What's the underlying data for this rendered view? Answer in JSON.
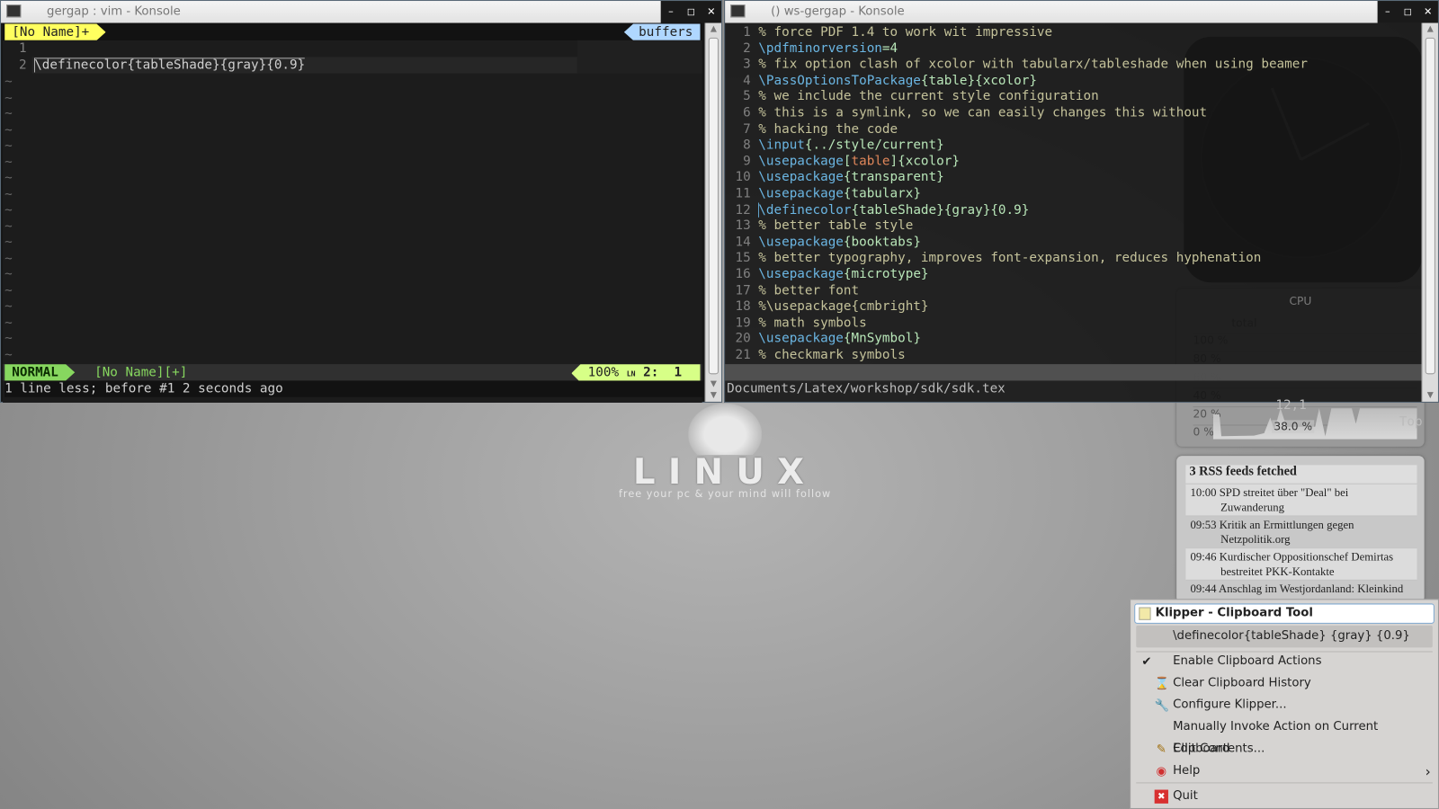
{
  "left_window": {
    "title": "gergap : vim - Konsole",
    "tabline": {
      "buffer": "[No Name]+",
      "right": "buffers"
    },
    "lines": [
      {
        "n": "1",
        "text": ""
      },
      {
        "n": "2",
        "text": "\\definecolor{tableShade}{gray}{0.9}"
      }
    ],
    "tilde": "~",
    "statusline": {
      "mode": "NORMAL",
      "file": "[No Name][+]",
      "percent": "100%",
      "ln_symbol": "LN",
      "pos": "2:  1"
    },
    "message": "1 line less; before #1  2 seconds ago",
    "colors": {
      "mode_bg": "#87d75f",
      "tab_bg": "#ffff5f",
      "buffers_bg": "#afd7ff",
      "pos_bg": "#d7ff87"
    }
  },
  "right_window": {
    "title": "() ws-gergap - Konsole",
    "lines": [
      [
        [
          "com",
          "% force PDF 1.4 to work wit impressive"
        ]
      ],
      [
        [
          "cmd",
          "\\pdfminorversion"
        ],
        [
          "txt",
          "=4"
        ]
      ],
      [
        [
          "com",
          "% fix option clash of xcolor with tabularx/tableshade when using beamer"
        ]
      ],
      [
        [
          "cmd",
          "\\PassOptionsToPackage"
        ],
        [
          "txt",
          "{table}{xcolor}"
        ]
      ],
      [
        [
          "com",
          "% we include the current style configuration"
        ]
      ],
      [
        [
          "com",
          "% this is a symlink, so we can easily changes this without"
        ]
      ],
      [
        [
          "com",
          "% hacking the code"
        ]
      ],
      [
        [
          "cmd",
          "\\input"
        ],
        [
          "txt",
          "{../style/current}"
        ]
      ],
      [
        [
          "cmd",
          "\\usepackage"
        ],
        [
          "txt",
          "["
        ],
        [
          "opt",
          "table"
        ],
        [
          "txt",
          "]{xcolor}"
        ]
      ],
      [
        [
          "cmd",
          "\\usepackage"
        ],
        [
          "txt",
          "{transparent}"
        ]
      ],
      [
        [
          "cmd",
          "\\usepackage"
        ],
        [
          "txt",
          "{tabularx}"
        ]
      ],
      [
        [
          "cmd",
          "\\definecolor"
        ],
        [
          "txt",
          "{tableShade}{gray}{0.9}"
        ]
      ],
      [
        [
          "com",
          "% better table style"
        ]
      ],
      [
        [
          "cmd",
          "\\usepackage"
        ],
        [
          "txt",
          "{booktabs}"
        ]
      ],
      [
        [
          "com",
          "% better typography, improves font-expansion, reduces hyphenation"
        ]
      ],
      [
        [
          "cmd",
          "\\usepackage"
        ],
        [
          "txt",
          "{microtype}"
        ]
      ],
      [
        [
          "com",
          "% better font"
        ]
      ],
      [
        [
          "com",
          "%\\usepackage{cmbright}"
        ]
      ],
      [
        [
          "com",
          "% math symbols"
        ]
      ],
      [
        [
          "cmd",
          "\\usepackage"
        ],
        [
          "txt",
          "{MnSymbol}"
        ]
      ],
      [
        [
          "com",
          "% checkmark symbols"
        ]
      ]
    ],
    "statusline": {
      "file": "Documents/Latex/workshop/sdk/sdk.tex",
      "pos": "12,1",
      "scroll": "Top"
    }
  },
  "desktop": {
    "logo_text": "LINUX",
    "logo_tagline": "free your pc & your mind will follow"
  },
  "cpu_widget": {
    "title": "CPU",
    "legend": "total",
    "ticks": [
      "100 %",
      "80 %",
      "60 %",
      "40 %",
      "20 %",
      "0 %"
    ],
    "value": "38.0 %"
  },
  "rss_widget": {
    "title": "3 RSS feeds fetched",
    "items": [
      {
        "time": "10:00",
        "text": "SPD streitet über \"Deal\" bei Zuwanderung"
      },
      {
        "time": "09:53",
        "text": "Kritik an Ermittlungen gegen Netzpolitik.org"
      },
      {
        "time": "09:46",
        "text": "Kurdischer Oppositionschef Demirtas bestreitet PKK-Kontakte"
      },
      {
        "time": "09:44",
        "text": "Anschlag im Westjordanland: Kleinkind"
      }
    ]
  },
  "klipper_menu": {
    "title": "Klipper - Clipboard Tool",
    "history_item": "\\definecolor{tableShade} {gray} {0.9}",
    "items": [
      {
        "label": "Enable Clipboard Actions",
        "icon": "check-icon",
        "checked": true
      },
      {
        "label": "Clear Clipboard History",
        "icon": "hourglass-icon"
      },
      {
        "label": "Configure Klipper...",
        "icon": "wrench-icon"
      },
      {
        "label": "Manually Invoke Action on Current Clipboard",
        "icon": ""
      },
      {
        "label": "Edit Contents...",
        "icon": "edit-icon"
      },
      {
        "label": "Help",
        "icon": "help-lifebuoy-icon",
        "submenu": true
      },
      {
        "label": "Quit",
        "icon": "quit-icon"
      }
    ]
  }
}
